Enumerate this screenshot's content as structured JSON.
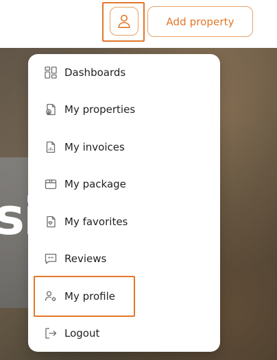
{
  "header": {
    "add_property_label": "Add property",
    "user_icon": "user-icon"
  },
  "hero": {
    "partial_text": "si"
  },
  "menu": {
    "items": [
      {
        "label": "Dashboards",
        "icon": "dashboard-icon"
      },
      {
        "label": "My properties",
        "icon": "properties-icon"
      },
      {
        "label": "My invoices",
        "icon": "invoice-icon"
      },
      {
        "label": "My package",
        "icon": "package-icon"
      },
      {
        "label": "My favorites",
        "icon": "favorites-icon"
      },
      {
        "label": "Reviews",
        "icon": "reviews-icon"
      },
      {
        "label": "My profile",
        "icon": "profile-icon"
      },
      {
        "label": "Logout",
        "icon": "logout-icon"
      }
    ]
  },
  "colors": {
    "accent": "#e2762a",
    "text": "#1f1f1f",
    "icon": "#6b6b6b"
  }
}
